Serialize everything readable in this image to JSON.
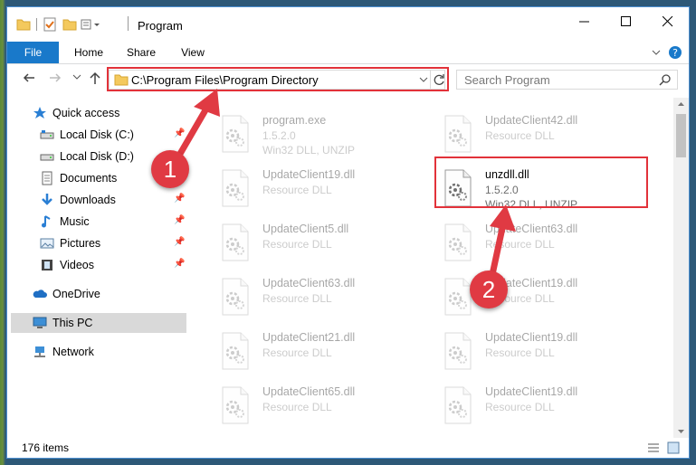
{
  "window": {
    "title": "Program"
  },
  "ribbon": {
    "tabs": [
      "File",
      "Home",
      "Share",
      "View"
    ]
  },
  "address": {
    "path": "C:\\Program Files\\Program Directory"
  },
  "search": {
    "placeholder": "Search Program"
  },
  "sidebar": {
    "items": [
      {
        "label": "Quick access",
        "icon": "star-icon",
        "pinned": false
      },
      {
        "label": "Local Disk (C:)",
        "icon": "drive-icon",
        "pinned": true
      },
      {
        "label": "Local Disk (D:)",
        "icon": "drive-icon",
        "pinned": false
      },
      {
        "label": "Documents",
        "icon": "documents-icon",
        "pinned": false
      },
      {
        "label": "Downloads",
        "icon": "downloads-icon",
        "pinned": true
      },
      {
        "label": "Music",
        "icon": "music-icon",
        "pinned": true
      },
      {
        "label": "Pictures",
        "icon": "pictures-icon",
        "pinned": true
      },
      {
        "label": "Videos",
        "icon": "videos-icon",
        "pinned": true
      },
      {
        "label": "OneDrive",
        "icon": "onedrive-icon",
        "pinned": false
      },
      {
        "label": "This PC",
        "icon": "pc-icon",
        "pinned": false
      },
      {
        "label": "Network",
        "icon": "network-icon",
        "pinned": false
      }
    ]
  },
  "files": [
    {
      "name": "program.exe",
      "version": "1.5.2.0",
      "type": "Win32 DLL, UNZIP",
      "faded": true
    },
    {
      "name": "UpdateClient42.dll",
      "version": "",
      "type": "Resource DLL",
      "faded": true
    },
    {
      "name": "UpdateClient19.dll",
      "version": "",
      "type": "Resource DLL",
      "faded": true
    },
    {
      "name": "unzdll.dll",
      "version": "1.5.2.0",
      "type": "Win32 DLL, UNZIP",
      "faded": false
    },
    {
      "name": "UpdateClient5.dll",
      "version": "",
      "type": "Resource DLL",
      "faded": true
    },
    {
      "name": "UpdateClient63.dll",
      "version": "",
      "type": "Resource DLL",
      "faded": true
    },
    {
      "name": "UpdateClient63.dll",
      "version": "",
      "type": "Resource DLL",
      "faded": true
    },
    {
      "name": "UpdateClient19.dll",
      "version": "",
      "type": "Resource DLL",
      "faded": true
    },
    {
      "name": "UpdateClient21.dll",
      "version": "",
      "type": "Resource DLL",
      "faded": true
    },
    {
      "name": "UpdateClient19.dll",
      "version": "",
      "type": "Resource DLL",
      "faded": true
    },
    {
      "name": "UpdateClient65.dll",
      "version": "",
      "type": "Resource DLL",
      "faded": true
    },
    {
      "name": "UpdateClient19.dll",
      "version": "",
      "type": "Resource DLL",
      "faded": true
    }
  ],
  "status": {
    "item_count": "176 items"
  },
  "annotations": {
    "step1": "1",
    "step2": "2",
    "color": "#e03a43"
  }
}
